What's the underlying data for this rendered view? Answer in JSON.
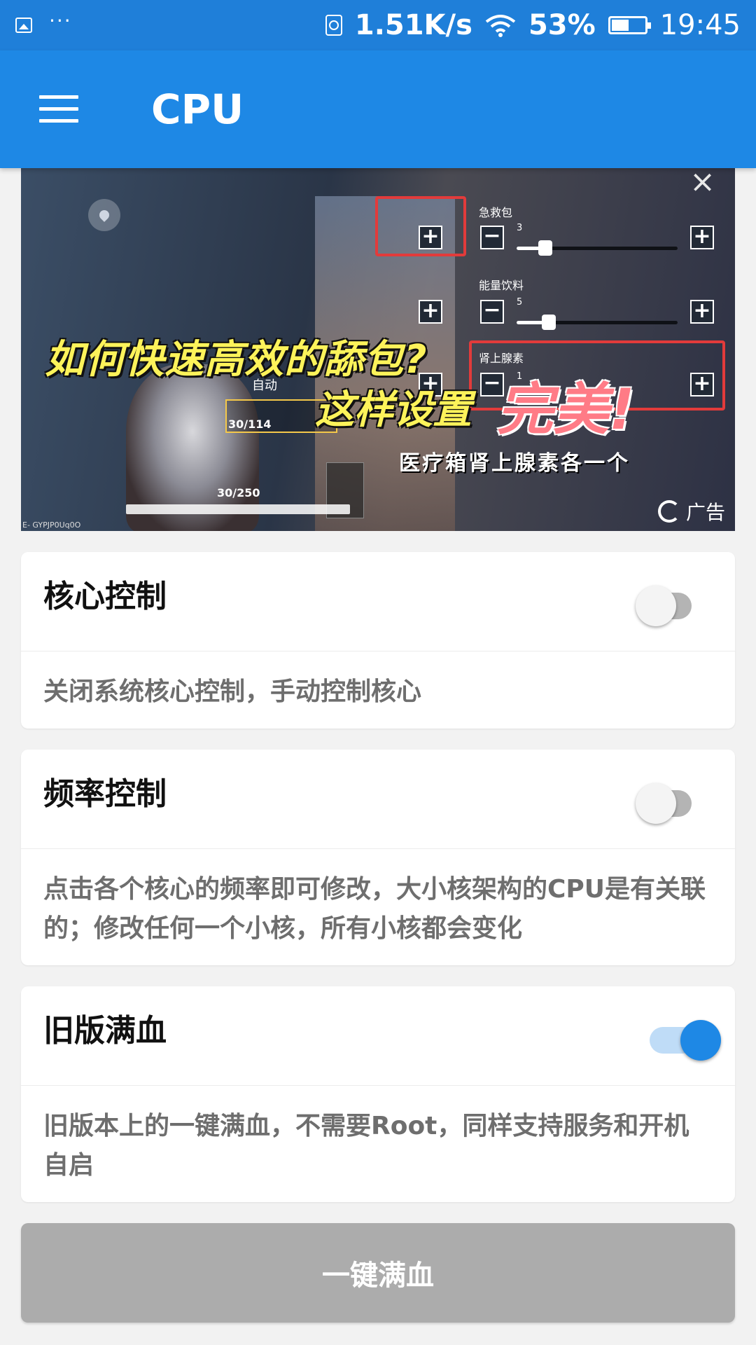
{
  "status_bar": {
    "net_speed": "1.51K/s",
    "battery_pct": "53%",
    "battery_level": 0.53,
    "time": "19:45",
    "dots": "···"
  },
  "app_bar": {
    "title": "CPU"
  },
  "ad": {
    "close": "×",
    "headline_1": "如何快速高效的舔包?",
    "headline_2": "这样设置",
    "headline_3": "完美!",
    "subtitle": "医疗箱肾上腺素各一个",
    "item_1_label": "急救包",
    "item_1_count": "3",
    "item_1_fill": 0.18,
    "item_2_label": "能量饮料",
    "item_2_count": "5",
    "item_2_fill": 0.2,
    "item_3_label": "肾上腺素",
    "item_3_count": "1",
    "hud_auto": "自动",
    "hud_ammo_1": "30/114",
    "hud_ammo_2": "30/250",
    "code": "E- GYPJP0Uq0O",
    "badge": "广告"
  },
  "cards": [
    {
      "title": "核心控制",
      "description": "关闭系统核心控制，手动控制核心",
      "enabled": false
    },
    {
      "title": "频率控制",
      "description": "点击各个核心的频率即可修改，大小核架构的CPU是有关联的；修改任何一个小核，所有小核都会变化",
      "enabled": false
    },
    {
      "title": "旧版满血",
      "description": "旧版本上的一键满血，不需要Root，同样支持服务和开机自启",
      "enabled": true
    }
  ],
  "button": {
    "label": "一键满血"
  },
  "colors": {
    "status_bar": "#1f7fd9",
    "primary": "#1e88e5",
    "switch_on_track": "#bfdcf7",
    "button_disabled": "#acacac"
  },
  "icons": [
    "gallery-icon",
    "screen-record-icon",
    "wifi-icon",
    "battery-icon",
    "menu-icon",
    "close-icon",
    "location-pin-icon",
    "ad-badge-icon"
  ]
}
